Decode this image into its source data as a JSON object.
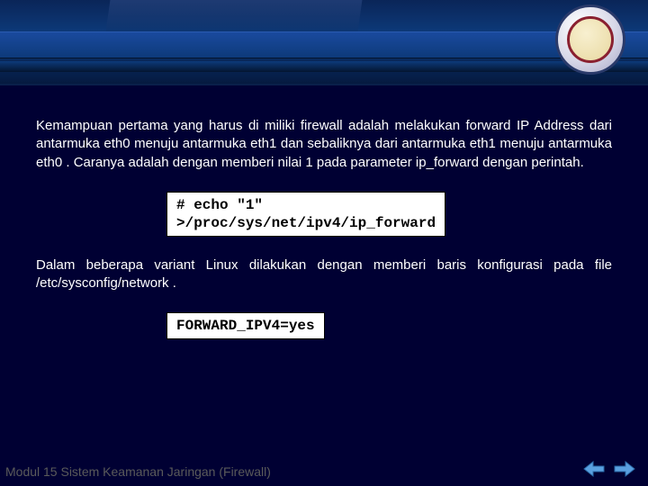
{
  "header": {
    "logo_text": ""
  },
  "body": {
    "para1": "Kemampuan pertama yang harus di miliki firewall adalah melakukan forward IP Address dari antarmuka eth0 menuju antarmuka eth1 dan sebaliknya dari antarmuka eth1 menuju antarmuka eth0 . Caranya adalah dengan memberi nilai 1 pada parameter ip_forward dengan perintah.",
    "code1_line1": "# echo \"1\"",
    "code1_line2": ">/proc/sys/net/ipv4/ip_forward",
    "para2": "Dalam beberapa variant Linux dilakukan dengan memberi baris konfigurasi pada file /etc/sysconfig/network .",
    "code2": "FORWARD_IPV4=yes"
  },
  "footer": {
    "text": "Modul 15 Sistem Keamanan Jaringan (Firewall)"
  },
  "nav": {
    "prev": "previous",
    "next": "next"
  },
  "colors": {
    "bg": "#000033",
    "header_grad": "#0d3a7a"
  }
}
